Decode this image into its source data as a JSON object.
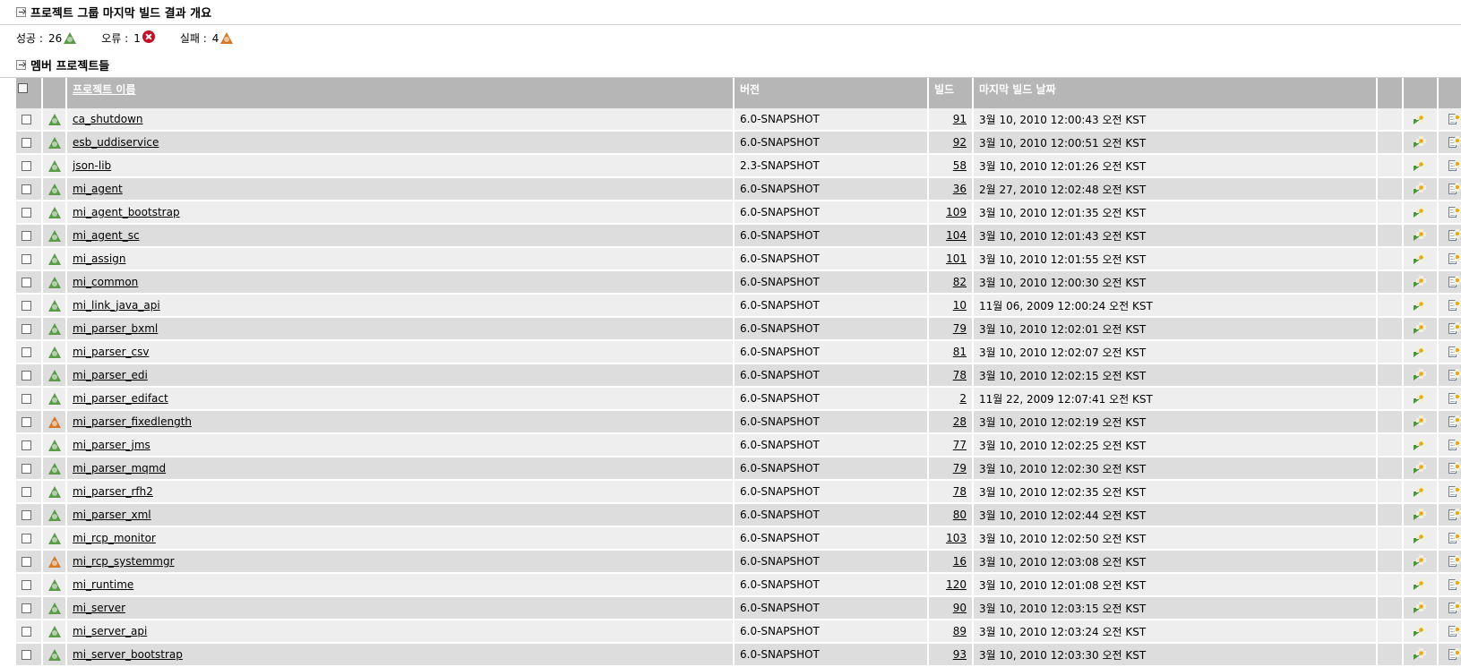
{
  "sections": {
    "summary_title": "프로젝트 그룹 마지막 빌드 결과 개요",
    "members_title": "멤버 프로젝트들"
  },
  "summary": {
    "success_label": "성공 :",
    "success_count": "26",
    "error_label": "오류 :",
    "error_count": "1",
    "failure_label": "실패 :",
    "failure_count": "4"
  },
  "table": {
    "headers": {
      "name": "프로젝트 이름",
      "version": "버전",
      "build": "빌드",
      "last_build_date": "마지막 빌드 날짜"
    },
    "rows": [
      {
        "status": "success",
        "name": "ca_shutdown",
        "version": "6.0-SNAPSHOT",
        "build": "91",
        "date": "3월 10, 2010 12:00:43 오전 KST"
      },
      {
        "status": "success",
        "name": "esb_uddiservice",
        "version": "6.0-SNAPSHOT",
        "build": "92",
        "date": "3월 10, 2010 12:00:51 오전 KST"
      },
      {
        "status": "success",
        "name": "json-lib",
        "version": "2.3-SNAPSHOT",
        "build": "58",
        "date": "3월 10, 2010 12:01:26 오전 KST"
      },
      {
        "status": "success",
        "name": "mi_agent",
        "version": "6.0-SNAPSHOT",
        "build": "36",
        "date": "2월 27, 2010 12:02:48 오전 KST"
      },
      {
        "status": "success",
        "name": "mi_agent_bootstrap",
        "version": "6.0-SNAPSHOT",
        "build": "109",
        "date": "3월 10, 2010 12:01:35 오전 KST"
      },
      {
        "status": "success",
        "name": "mi_agent_sc",
        "version": "6.0-SNAPSHOT",
        "build": "104",
        "date": "3월 10, 2010 12:01:43 오전 KST"
      },
      {
        "status": "success",
        "name": "mi_assign",
        "version": "6.0-SNAPSHOT",
        "build": "101",
        "date": "3월 10, 2010 12:01:55 오전 KST"
      },
      {
        "status": "success",
        "name": "mi_common",
        "version": "6.0-SNAPSHOT",
        "build": "82",
        "date": "3월 10, 2010 12:00:30 오전 KST"
      },
      {
        "status": "success",
        "name": "mi_link_java_api",
        "version": "6.0-SNAPSHOT",
        "build": "10",
        "date": "11월 06, 2009 12:00:24 오전 KST"
      },
      {
        "status": "success",
        "name": "mi_parser_bxml",
        "version": "6.0-SNAPSHOT",
        "build": "79",
        "date": "3월 10, 2010 12:02:01 오전 KST"
      },
      {
        "status": "success",
        "name": "mi_parser_csv",
        "version": "6.0-SNAPSHOT",
        "build": "81",
        "date": "3월 10, 2010 12:02:07 오전 KST"
      },
      {
        "status": "success",
        "name": "mi_parser_edi",
        "version": "6.0-SNAPSHOT",
        "build": "78",
        "date": "3월 10, 2010 12:02:15 오전 KST"
      },
      {
        "status": "success",
        "name": "mi_parser_edifact",
        "version": "6.0-SNAPSHOT",
        "build": "2",
        "date": "11월 22, 2009 12:07:41 오전 KST"
      },
      {
        "status": "failure",
        "name": "mi_parser_fixedlength",
        "version": "6.0-SNAPSHOT",
        "build": "28",
        "date": "3월 10, 2010 12:02:19 오전 KST"
      },
      {
        "status": "success",
        "name": "mi_parser_jms",
        "version": "6.0-SNAPSHOT",
        "build": "77",
        "date": "3월 10, 2010 12:02:25 오전 KST"
      },
      {
        "status": "success",
        "name": "mi_parser_mqmd",
        "version": "6.0-SNAPSHOT",
        "build": "79",
        "date": "3월 10, 2010 12:02:30 오전 KST"
      },
      {
        "status": "success",
        "name": "mi_parser_rfh2",
        "version": "6.0-SNAPSHOT",
        "build": "78",
        "date": "3월 10, 2010 12:02:35 오전 KST"
      },
      {
        "status": "success",
        "name": "mi_parser_xml",
        "version": "6.0-SNAPSHOT",
        "build": "80",
        "date": "3월 10, 2010 12:02:44 오전 KST"
      },
      {
        "status": "success",
        "name": "mi_rcp_monitor",
        "version": "6.0-SNAPSHOT",
        "build": "103",
        "date": "3월 10, 2010 12:02:50 오전 KST"
      },
      {
        "status": "failure",
        "name": "mi_rcp_systemmgr",
        "version": "6.0-SNAPSHOT",
        "build": "16",
        "date": "3월 10, 2010 12:03:08 오전 KST"
      },
      {
        "status": "success",
        "name": "mi_runtime",
        "version": "6.0-SNAPSHOT",
        "build": "120",
        "date": "3월 10, 2010 12:01:08 오전 KST"
      },
      {
        "status": "success",
        "name": "mi_server",
        "version": "6.0-SNAPSHOT",
        "build": "90",
        "date": "3월 10, 2010 12:03:15 오전 KST"
      },
      {
        "status": "success",
        "name": "mi_server_api",
        "version": "6.0-SNAPSHOT",
        "build": "89",
        "date": "3월 10, 2010 12:03:24 오전 KST"
      },
      {
        "status": "success",
        "name": "mi_server_bootstrap",
        "version": "6.0-SNAPSHOT",
        "build": "93",
        "date": "3월 10, 2010 12:03:30 오전 KST"
      }
    ]
  },
  "icons": {
    "expand": "expand-icon",
    "build": "build-icon",
    "build_doc": "build-with-doc-icon",
    "report": "report-icon",
    "package": "package-icon",
    "delete": "delete-icon",
    "status_success": "success-triangle-icon",
    "status_failure": "failure-triangle-icon",
    "status_error": "error-circle-icon"
  },
  "colors": {
    "header_bg": "#b6b6b6",
    "row_odd": "#eeeeee",
    "row_even": "#dddddd",
    "success": "#5a9a48",
    "failure": "#d4792a",
    "error": "#c1122a"
  }
}
